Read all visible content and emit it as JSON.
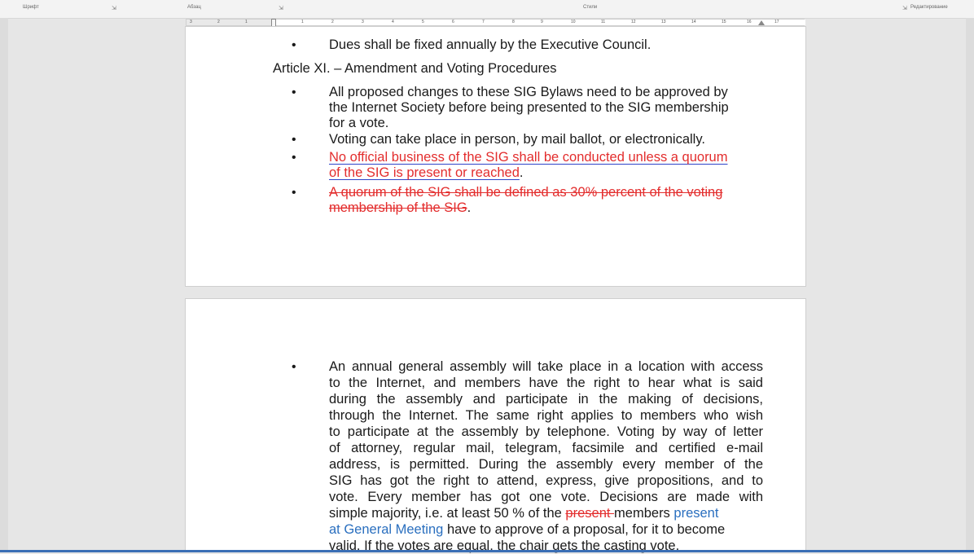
{
  "ribbon": {
    "groups": [
      "Шрифт",
      "Абзац",
      "Стили",
      "Редактирование"
    ]
  },
  "ruler": {
    "labels": [
      "3",
      "2",
      "1",
      "1",
      "2",
      "3",
      "4",
      "5",
      "6",
      "7",
      "8",
      "9",
      "10",
      "11",
      "12",
      "13",
      "14",
      "15",
      "16",
      "17"
    ]
  },
  "page1": {
    "l1": "Dues shall be fixed annually by the Executive Council.",
    "article": "Article XI. – Amendment and Voting Procedures",
    "b1": [
      "All proposed changes to these SIG Bylaws need to be approved by",
      "the Internet Society before being presented to the SIG membership",
      "for a vote."
    ],
    "b2": "Voting can take place in person, by mail ballot, or electronically.",
    "b3": [
      "No official business of the SIG shall be conducted unless a quorum",
      "of the SIG is present or reached"
    ],
    "b3_period": ".",
    "b4": [
      "A quorum of the SIG shall be defined as 30% percent of the voting",
      "membership of the SIG"
    ],
    "b4_period": "."
  },
  "page2": {
    "lines": [
      "An annual general assembly will take place in a location with access",
      "to the Internet, and members have the right to hear what is said",
      "during the assembly and participate in the making of decisions,",
      "through the Internet. The same right applies to members who wish",
      "to participate at the assembly by telephone. Voting by way of letter",
      "of attorney, regular mail, telegram, facsimile and certified e-mail",
      "address, is permitted. During the assembly every member of the",
      "SIG has got the right to attend, express, give propositions, and to",
      "vote. Every member has got one vote. Decisions are made with"
    ],
    "l10_a": "simple majority, i.e. at least 50 % of the",
    "l10_del": "present ",
    "l10_b": "members",
    "l10_ins": "present",
    "l11_ins": "at General Meeting",
    "l11_b": "have to approve of a proposal, for it to become",
    "l12": "valid. If the votes are equal, the chair gets the casting vote."
  },
  "bullet_char": "•",
  "colors": {
    "deleted": "#e32d2d",
    "inserted": "#2a6fbf"
  }
}
